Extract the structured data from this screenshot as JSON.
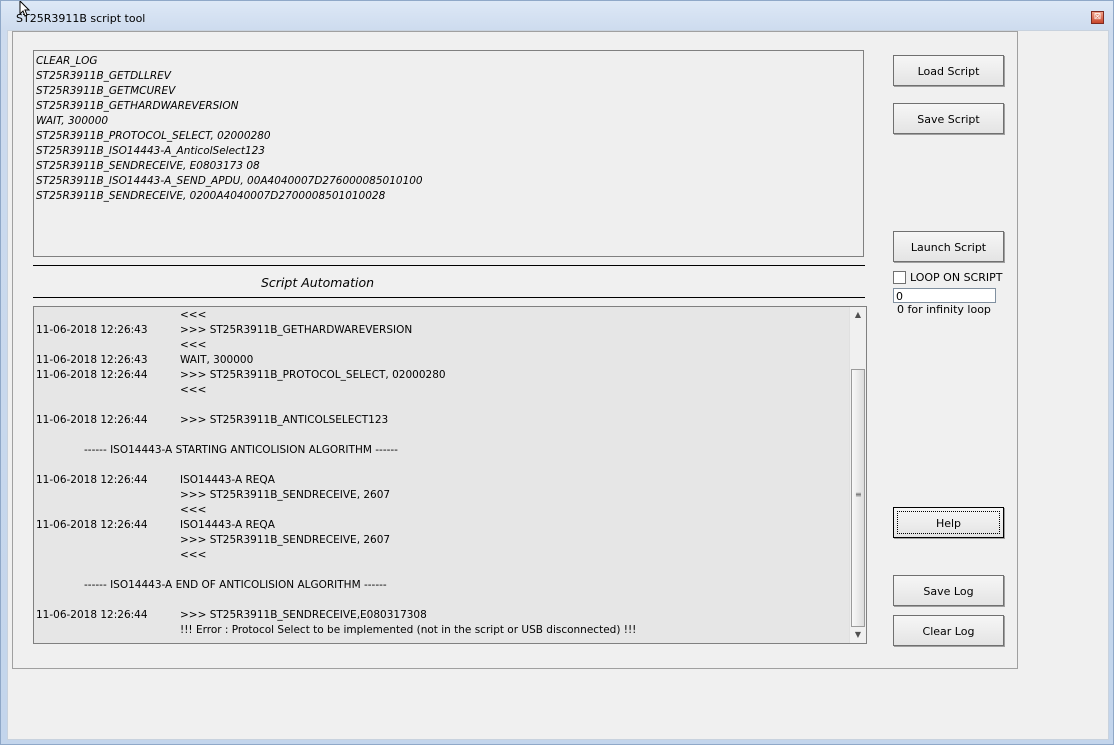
{
  "window": {
    "title": "ST25R3911B script tool",
    "close_glyph": "⊠"
  },
  "script_lines": [
    "CLEAR_LOG",
    "ST25R3911B_GETDLLREV",
    "ST25R3911B_GETMCUREV",
    "ST25R3911B_GETHARDWAREVERSION",
    "WAIT, 300000",
    "ST25R3911B_PROTOCOL_SELECT, 02000280",
    "ST25R3911B_ISO14443-A_AnticolSelect123",
    "ST25R3911B_SENDRECEIVE, E0803173 08",
    "ST25R3911B_ISO14443-A_SEND_APDU, 00A4040007D276000085010100",
    "ST25R3911B_SENDRECEIVE, 0200A4040007D2700008501010028"
  ],
  "section_title": "Script Automation",
  "log_rows": [
    {
      "ts": "",
      "msg": "<<<"
    },
    {
      "ts": "11-06-2018 12:26:43",
      "msg": ">>> ST25R3911B_GETHARDWAREVERSION"
    },
    {
      "ts": "",
      "msg": "<<<"
    },
    {
      "ts": "11-06-2018 12:26:43",
      "msg": "WAIT, 300000"
    },
    {
      "ts": "11-06-2018 12:26:44",
      "msg": ">>> ST25R3911B_PROTOCOL_SELECT, 02000280"
    },
    {
      "ts": "",
      "msg": "<<<"
    },
    {
      "ts": "",
      "msg": ""
    },
    {
      "ts": "11-06-2018 12:26:44",
      "msg": ">>> ST25R3911B_ANTICOLSELECT123"
    },
    {
      "ts": "",
      "msg": ""
    },
    {
      "center": "------ ISO14443-A STARTING ANTICOLISION ALGORITHM ------"
    },
    {
      "ts": "",
      "msg": ""
    },
    {
      "ts": "11-06-2018 12:26:44",
      "msg": "ISO14443-A REQA"
    },
    {
      "ts": "",
      "msg": ">>> ST25R3911B_SENDRECEIVE, 2607"
    },
    {
      "ts": "",
      "msg": "<<<"
    },
    {
      "ts": "11-06-2018 12:26:44",
      "msg": "ISO14443-A REQA"
    },
    {
      "ts": "",
      "msg": ">>> ST25R3911B_SENDRECEIVE, 2607"
    },
    {
      "ts": "",
      "msg": "<<<"
    },
    {
      "ts": "",
      "msg": ""
    },
    {
      "center": "------ ISO14443-A END OF ANTICOLISION ALGORITHM ------"
    },
    {
      "ts": "",
      "msg": ""
    },
    {
      "ts": "11-06-2018 12:26:44",
      "msg": ">>> ST25R3911B_SENDRECEIVE,E080317308"
    },
    {
      "ts": "",
      "msg": "!!! Error : Protocol Select to be implemented (not in the script or USB disconnected) !!!"
    }
  ],
  "buttons": {
    "load_script": "Load Script",
    "save_script": "Save Script",
    "launch_script": "Launch Script",
    "help": "Help",
    "save_log": "Save Log",
    "clear_log": "Clear Log"
  },
  "loop": {
    "label": "LOOP ON SCRIPT",
    "checked": false,
    "value": "0",
    "hint": "0 for infinity loop"
  },
  "scrollbar": {
    "up_glyph": "▲",
    "down_glyph": "▼",
    "grip_glyph": "≡"
  }
}
